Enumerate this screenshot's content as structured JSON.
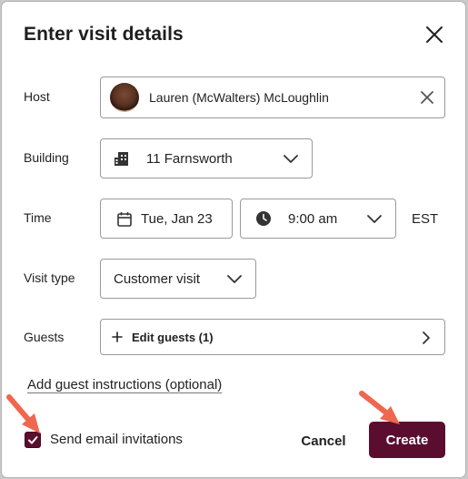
{
  "dialog": {
    "title": "Enter visit details"
  },
  "form": {
    "host": {
      "label": "Host",
      "value": "Lauren (McWalters) McLoughlin"
    },
    "building": {
      "label": "Building",
      "value": "11 Farnsworth"
    },
    "time": {
      "label": "Time",
      "date": "Tue, Jan 23",
      "time": "9:00 am",
      "timezone": "EST"
    },
    "visit_type": {
      "label": "Visit type",
      "value": "Customer visit"
    },
    "guests": {
      "label": "Guests",
      "button_label": "Edit guests (1)"
    },
    "instructions_link": "Add guest instructions (optional)",
    "send_email": {
      "label": "Send email invitations",
      "checked": true
    }
  },
  "footer": {
    "cancel_label": "Cancel",
    "create_label": "Create"
  },
  "colors": {
    "primary": "#5b0d30",
    "annotation_arrow": "#f0664f"
  },
  "icons": {
    "close": "close-icon",
    "clear": "clear-icon",
    "building": "building-icon",
    "calendar": "calendar-icon",
    "clock": "clock-icon",
    "chevron_down": "chevron-down-icon",
    "chevron_right": "chevron-right-icon",
    "plus": "plus-icon",
    "check": "checkmark-icon"
  }
}
